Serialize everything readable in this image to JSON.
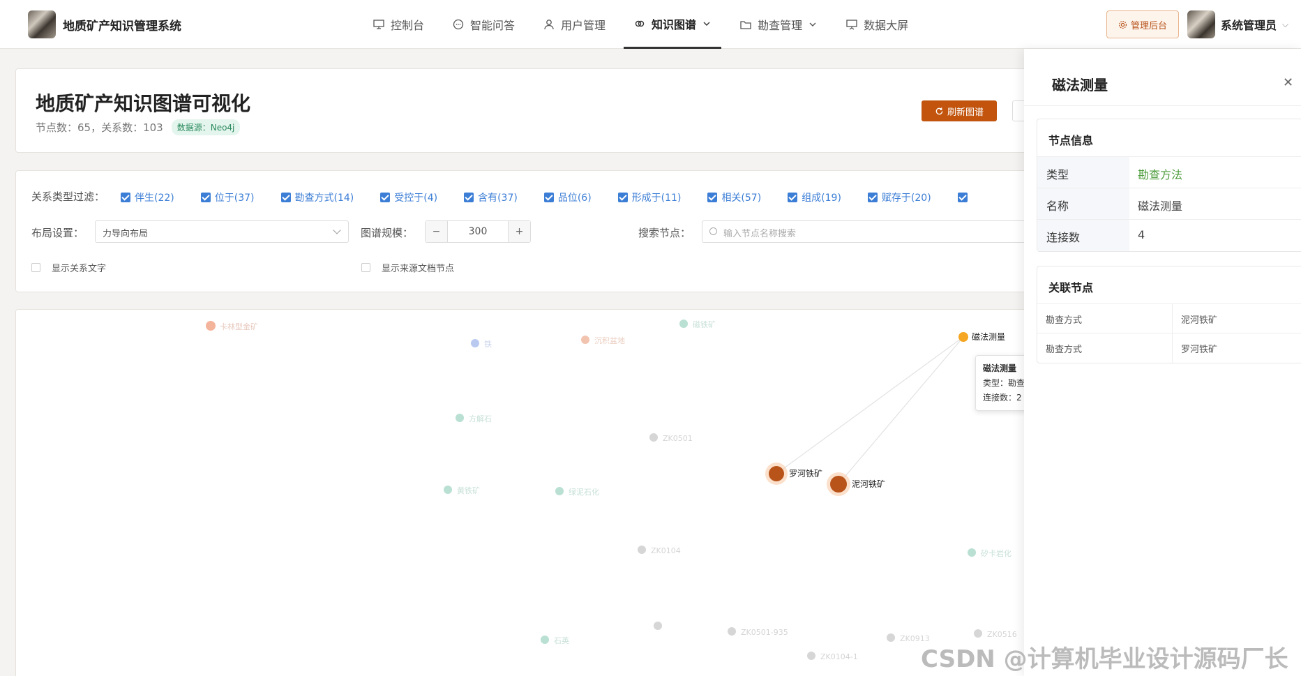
{
  "app": {
    "title": "地质矿产知识管理系统"
  },
  "nav": {
    "items": [
      {
        "label": "控制台"
      },
      {
        "label": "智能问答"
      },
      {
        "label": "用户管理"
      },
      {
        "label": "知识图谱"
      },
      {
        "label": "勘查管理"
      },
      {
        "label": "数据大屏"
      }
    ]
  },
  "header": {
    "admin_label": "管理后台",
    "user_name": "系统管理员"
  },
  "page": {
    "title": "地质矿产知识图谱可视化",
    "stats": "节点数：65，关系数：103",
    "datasource": "数据源：Neo4j",
    "refresh_label": "刷新图谱"
  },
  "filters": {
    "relation_label": "关系类型过滤：",
    "relations": [
      {
        "label": "伴生(22)"
      },
      {
        "label": "位于(37)"
      },
      {
        "label": "勘查方式(14)"
      },
      {
        "label": "受控于(4)"
      },
      {
        "label": "含有(37)"
      },
      {
        "label": "品位(6)"
      },
      {
        "label": "形成于(11)"
      },
      {
        "label": "相关(57)"
      },
      {
        "label": "组成(19)"
      },
      {
        "label": "赋存于(20)"
      }
    ],
    "layout_label": "布局设置：",
    "layout_value": "力导向布局",
    "scale_label": "图谱规模：",
    "scale_value": "300",
    "search_label": "搜索节点：",
    "search_placeholder": "输入节点名称搜索",
    "show_relation_text": "显示关系文字",
    "show_source_nodes": "显示来源文档节点"
  },
  "graph": {
    "nodes": [
      {
        "label": "卡林型金矿",
        "color": "#f4b49c"
      },
      {
        "label": "铁",
        "color": "#b9c9f0"
      },
      {
        "label": "沉积盆地",
        "color": "#f2c4b0"
      },
      {
        "label": "磁铁矿",
        "color": "#b9e0d3"
      },
      {
        "label": "磁法测量",
        "color": "#f5a623"
      },
      {
        "label": "方解石",
        "color": "#b9e0d3"
      },
      {
        "label": "ZK0501",
        "color": "#d6d6d6"
      },
      {
        "label": "罗河铁矿",
        "color": "#b8531a"
      },
      {
        "label": "泥河铁矿",
        "color": "#b8531a"
      },
      {
        "label": "黄铁矿",
        "color": "#b9e0d3"
      },
      {
        "label": "绿泥石化",
        "color": "#b9e0d3"
      },
      {
        "label": "ZK0104",
        "color": "#d6d6d6"
      },
      {
        "label": "矽卡岩化",
        "color": "#b9e0d3"
      },
      {
        "label": "石英",
        "color": "#b9e0d3"
      },
      {
        "label": "ZK0501-935",
        "color": "#d6d6d6"
      },
      {
        "label": "ZK0913",
        "color": "#d6d6d6"
      },
      {
        "label": "ZK0516",
        "color": "#d6d6d6"
      },
      {
        "label": "ZK0104-1",
        "color": "#d6d6d6"
      }
    ]
  },
  "tooltip": {
    "title": "磁法测量",
    "type": "类型：勘查方法",
    "degree": "连接数：2"
  },
  "drawer": {
    "title": "磁法测量",
    "node_info_title": "节点信息",
    "info": [
      {
        "key": "类型",
        "value": "勘查方法"
      },
      {
        "key": "名称",
        "value": "磁法测量"
      },
      {
        "key": "连接数",
        "value": "4"
      }
    ],
    "related_title": "关联节点",
    "related": [
      {
        "relation": "勘查方式",
        "node": "泥河铁矿"
      },
      {
        "relation": "勘查方式",
        "node": "罗河铁矿"
      }
    ]
  },
  "watermark": "CSDN @计算机毕业设计源码厂长"
}
